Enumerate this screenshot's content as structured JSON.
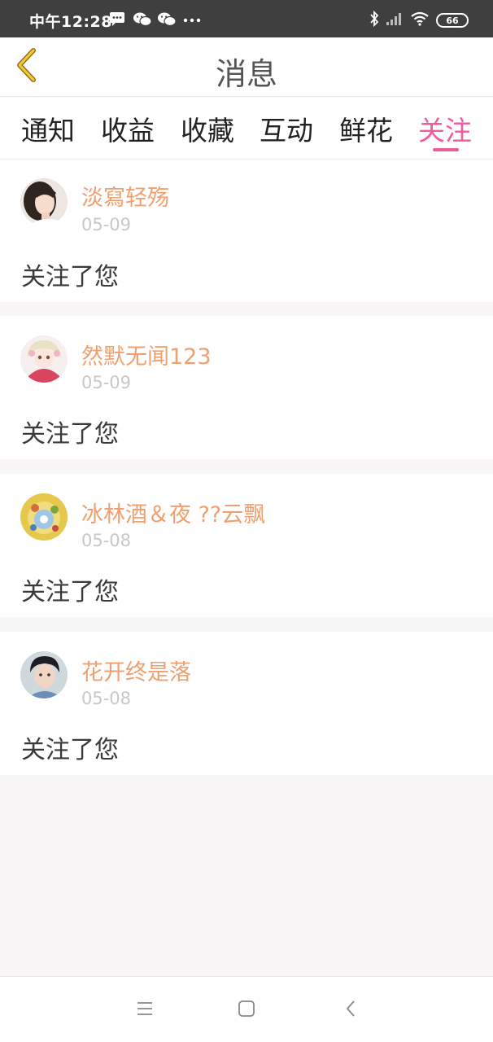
{
  "status_bar": {
    "time": "中午12:28",
    "battery": "66",
    "left_icons": [
      "message-icon",
      "wechat-icon",
      "wechat-icon",
      "more-dots-icon"
    ],
    "right_icons": [
      "bluetooth-icon",
      "signal-icon",
      "wifi-icon",
      "battery-icon"
    ]
  },
  "header": {
    "title": "消息",
    "back_icon": "chevron-left-icon"
  },
  "tabs": {
    "items": [
      "通知",
      "收益",
      "收藏",
      "互动",
      "鲜花",
      "关注"
    ],
    "active": "关注"
  },
  "messages": [
    {
      "name": "淡寫轻殇",
      "date": "05-09",
      "text": "关注了您"
    },
    {
      "name": "然默无闻123",
      "date": "05-09",
      "text": "关注了您"
    },
    {
      "name": "冰林酒＆夜 ??云飘",
      "date": "05-08",
      "text": "关注了您"
    },
    {
      "name": "花开终是落",
      "date": "05-08",
      "text": "关注了您"
    }
  ],
  "nav_bar": {
    "icons": [
      "menu-icon",
      "home-square-icon",
      "back-arrow-icon"
    ]
  },
  "colors": {
    "accent": "#ef5c9e",
    "username": "#f0a06e",
    "date": "#c8c8c8",
    "status_bar_bg": "#3f3f3f",
    "page_bg": "#f8f6f7"
  }
}
